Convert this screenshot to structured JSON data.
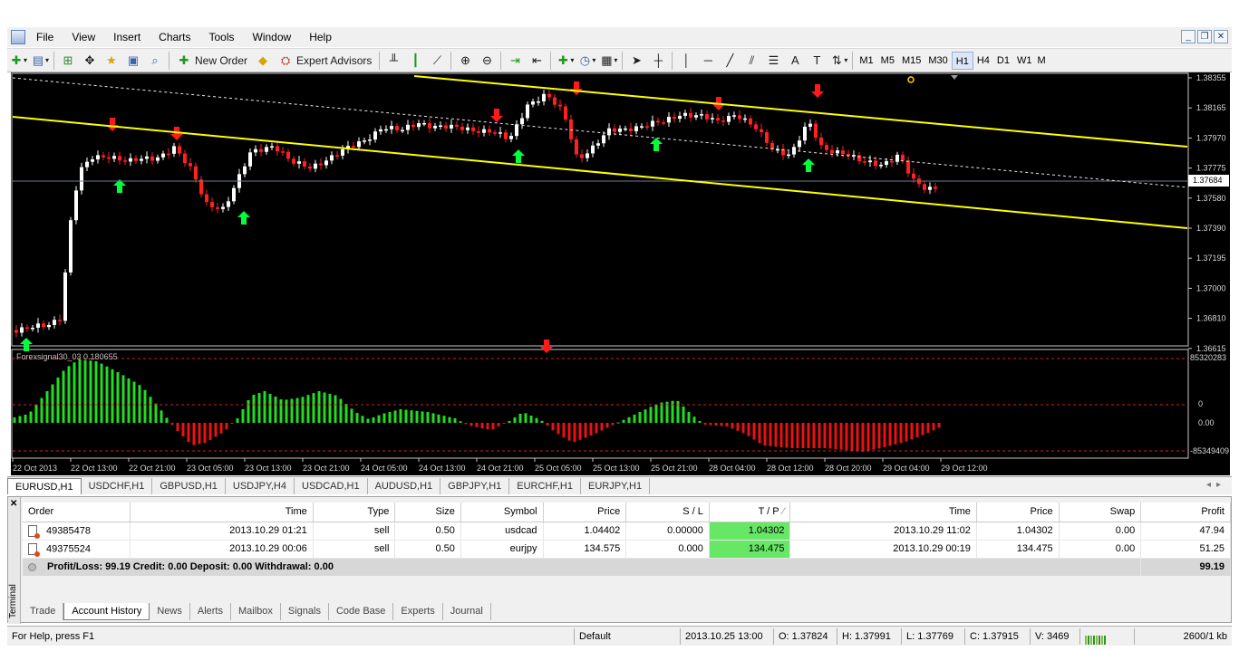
{
  "menu": [
    "File",
    "View",
    "Insert",
    "Charts",
    "Tools",
    "Window",
    "Help"
  ],
  "toolbar": {
    "new_order_label": "New Order",
    "expert_advisors_label": "Expert Advisors",
    "timeframes": [
      "M1",
      "M5",
      "M15",
      "M30",
      "H1",
      "H4",
      "D1",
      "W1",
      "MN"
    ],
    "active_timeframe": "H1"
  },
  "chart": {
    "price_labels": [
      "1.38355",
      "1.38165",
      "1.37970",
      "1.37775",
      "1.37580",
      "1.37390",
      "1.37195",
      "1.37000",
      "1.36810",
      "1.36615"
    ],
    "current_price": "1.37684",
    "indicator_label": "Forexsignal30_03 0.180655",
    "indicator_levels": [
      "85320283",
      "0",
      "0.00",
      "-85349409"
    ],
    "time_labels": [
      "22 Oct 2013",
      "22 Oct 13:00",
      "22 Oct 21:00",
      "23 Oct 05:00",
      "23 Oct 13:00",
      "23 Oct 21:00",
      "24 Oct 05:00",
      "24 Oct 13:00",
      "24 Oct 21:00",
      "25 Oct 05:00",
      "25 Oct 13:00",
      "25 Oct 21:00",
      "28 Oct 04:00",
      "28 Oct 12:00",
      "28 Oct 20:00",
      "29 Oct 04:00",
      "29 Oct 12:00"
    ],
    "colors": {
      "bull": "#ffffff",
      "bear": "#ff2020",
      "channel": "#ffff00",
      "buy_arrow": "#00ff3c",
      "sell_arrow": "#ff1a1a",
      "hist_pos": "#22dd22",
      "hist_neg": "#ee1111"
    }
  },
  "chart_tabs": [
    "EURUSD,H1",
    "USDCHF,H1",
    "GBPUSD,H1",
    "USDJPY,H4",
    "USDCAD,H1",
    "AUDUSD,H1",
    "GBPJPY,H1",
    "EURCHF,H1",
    "EURJPY,H1"
  ],
  "active_chart_tab": "EURUSD,H1",
  "terminal": {
    "label": "Terminal",
    "columns": [
      "Order",
      "Time",
      "Type",
      "Size",
      "Symbol",
      "Price",
      "S / L",
      "T / P",
      "Time",
      "Price",
      "Swap",
      "Profit"
    ],
    "rows": [
      {
        "order": "49385478",
        "open_time": "2013.10.29 01:21",
        "type": "sell",
        "size": "0.50",
        "symbol": "usdcad",
        "open_price": "1.04402",
        "sl": "0.00000",
        "tp": "1.04302",
        "close_time": "2013.10.29 11:02",
        "close_price": "1.04302",
        "swap": "0.00",
        "profit": "47.94"
      },
      {
        "order": "49375524",
        "open_time": "2013.10.29 00:06",
        "type": "sell",
        "size": "0.50",
        "symbol": "eurjpy",
        "open_price": "134.575",
        "sl": "0.000",
        "tp": "134.475",
        "close_time": "2013.10.29 00:19",
        "close_price": "134.475",
        "swap": "0.00",
        "profit": "51.25"
      }
    ],
    "summary_text": "Profit/Loss: 99.19  Credit: 0.00  Deposit: 0.00  Withdrawal: 0.00",
    "summary_total": "99.19",
    "tabs": [
      "Trade",
      "Account History",
      "News",
      "Alerts",
      "Mailbox",
      "Signals",
      "Code Base",
      "Experts",
      "Journal"
    ],
    "active_tab": "Account History"
  },
  "status": {
    "help": "For Help, press F1",
    "profile": "Default",
    "datetime": "2013.10.25 13:00",
    "open": "O: 1.37824",
    "high": "H: 1.37991",
    "low": "L: 1.37769",
    "close": "C: 1.37915",
    "volume": "V: 3469",
    "traffic": "2600/1 kb"
  }
}
